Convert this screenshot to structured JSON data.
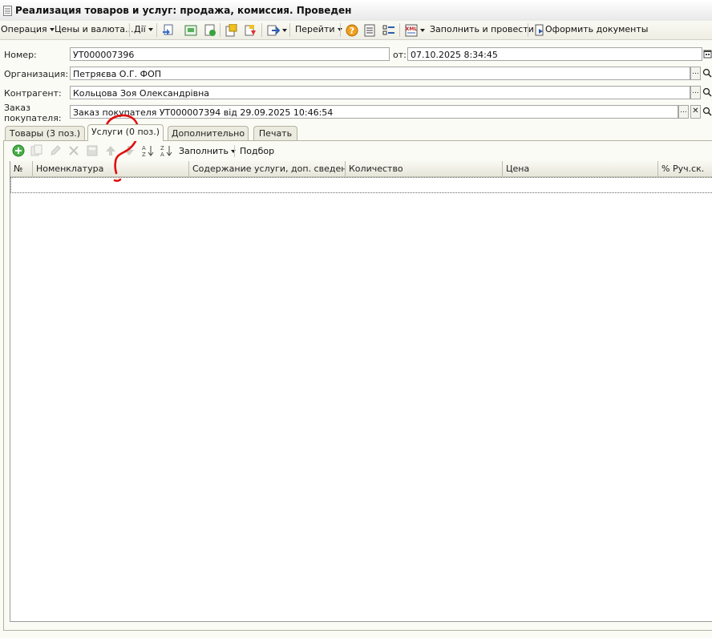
{
  "window": {
    "title": "Реализация товаров и услуг: продажа, комиссия. Проведен"
  },
  "toolbar": {
    "operation": "Операция",
    "prices": "Цены и валюта...",
    "actions": "Дії",
    "goto": "Перейти",
    "fill_post": "Заполнить и провести",
    "make_docs": "Оформить документы"
  },
  "form": {
    "number_label": "Номер:",
    "number_value": "УТ000007396",
    "date_label": "от:",
    "date_value": "07.10.2025  8:34:45",
    "org_label": "Организация:",
    "org_value": "Петряєва О.Г. ФОП",
    "contractor_label": "Контрагент:",
    "contractor_value": "Кольцова Зоя Олександрівна",
    "order_label_1": "Заказ",
    "order_label_2": "покупателя:",
    "order_value": "Заказ покупателя УТ000007394 від 29.09.2025 10:46:54",
    "select_btn": "...",
    "clear_btn": "✕"
  },
  "tabs": [
    {
      "label": "Товары (3 поз.)"
    },
    {
      "label": "Услуги (0 поз.)"
    },
    {
      "label": "Дополнительно"
    },
    {
      "label": "Печать"
    }
  ],
  "services": {
    "fill_label": "Заполнить",
    "select_label": "Подбор",
    "columns": [
      "№",
      "Номенклатура",
      "Содержание услуги, доп. сведения",
      "Количество",
      "Цена",
      "% Руч.ск."
    ]
  },
  "colors": {
    "accent_green": "#3aa33a",
    "annotation_red": "#e01010"
  }
}
